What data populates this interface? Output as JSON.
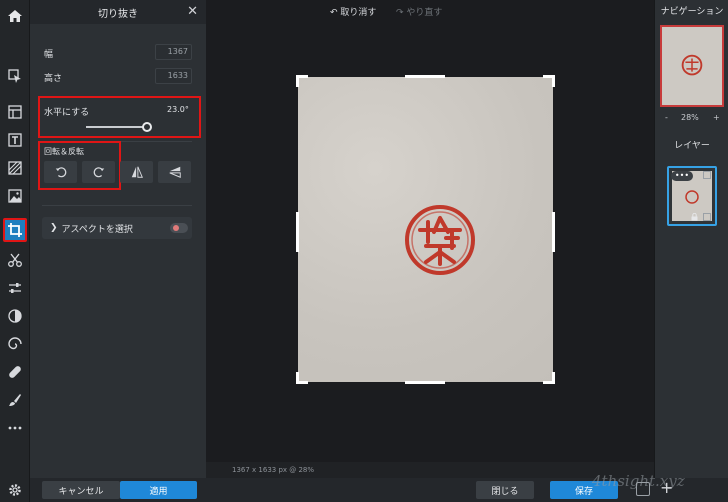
{
  "toolbar": {
    "items": [
      "home-icon",
      "arrange-icon",
      "layout-icon",
      "text-icon",
      "pattern-icon",
      "image-icon",
      "crop-icon",
      "scissors-icon",
      "adjust-icon",
      "filter-icon",
      "swirl-icon",
      "heal-icon",
      "brush-icon",
      "more-icon",
      "settings-icon"
    ],
    "active": "crop-icon"
  },
  "panel": {
    "title": "切り抜き",
    "width_label": "幅",
    "width_value": "1367",
    "height_label": "高さ",
    "height_value": "1633",
    "straighten_label": "水平にする",
    "straighten_value": "23.0°",
    "straighten_fraction": 0.98,
    "rotate_flip_label": "回転＆反転",
    "aspect_label": "アスペクトを選択",
    "cancel_label": "キャンセル",
    "apply_label": "適用"
  },
  "canvas": {
    "status": "1367 x 1633 px @ 28%",
    "stamp_text": "鈴木"
  },
  "actionbar": {
    "undo_label": "取り消す",
    "redo_label": "やり直す",
    "close_label": "閉じる",
    "save_label": "保存",
    "watermark": "4thsight.xyz"
  },
  "rightpanel": {
    "navigation_title": "ナビゲーション",
    "zoom_value": "28%",
    "zoom_minus": "-",
    "zoom_plus": "+",
    "layers_title": "レイヤー",
    "layer_menu": "•••"
  },
  "colors": {
    "accent": "#1f88d8",
    "highlight": "#e01515",
    "stamp_red": "#c0392b"
  }
}
